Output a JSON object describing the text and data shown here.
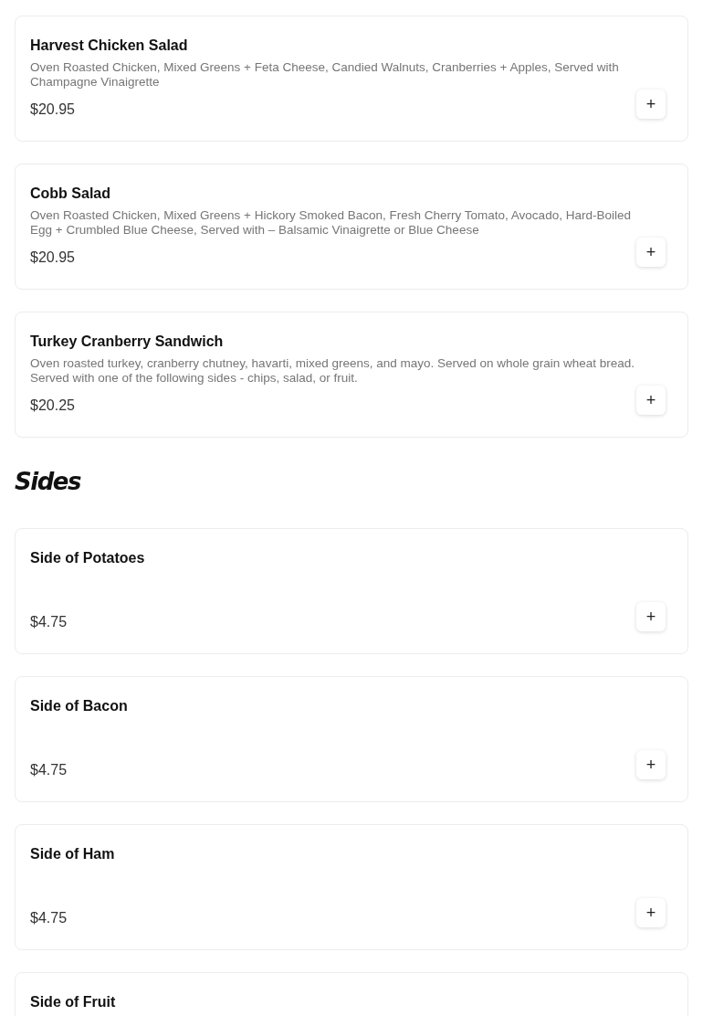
{
  "sections": [
    {
      "items": [
        {
          "name": "Harvest Chicken Salad",
          "description": "Oven Roasted Chicken, Mixed Greens + Feta Cheese, Candied Walnuts, Cranberries + Apples, Served with Champagne Vinaigrette",
          "price": "$20.95",
          "add_button": "+"
        },
        {
          "name": "Cobb Salad",
          "description": "Oven Roasted Chicken, Mixed Greens + Hickory Smoked Bacon, Fresh Cherry Tomato, Avocado, Hard-Boiled Egg + Crumbled Blue Cheese, Served with – Balsamic Vinaigrette or Blue Cheese",
          "price": "$20.95",
          "add_button": "+"
        },
        {
          "name": "Turkey Cranberry Sandwich",
          "description": "Oven roasted turkey, cranberry chutney, havarti, mixed greens, and mayo. Served on whole grain wheat bread. Served with one of the following sides - chips, salad, or fruit.",
          "price": "$20.25",
          "add_button": "+"
        }
      ]
    },
    {
      "title": "Sides",
      "items": [
        {
          "name": "Side of Potatoes",
          "price": "$4.75",
          "add_button": "+"
        },
        {
          "name": "Side of Bacon",
          "price": "$4.75",
          "add_button": "+"
        },
        {
          "name": "Side of Ham",
          "price": "$4.75",
          "add_button": "+"
        },
        {
          "name": "Side of Fruit"
        }
      ]
    }
  ]
}
